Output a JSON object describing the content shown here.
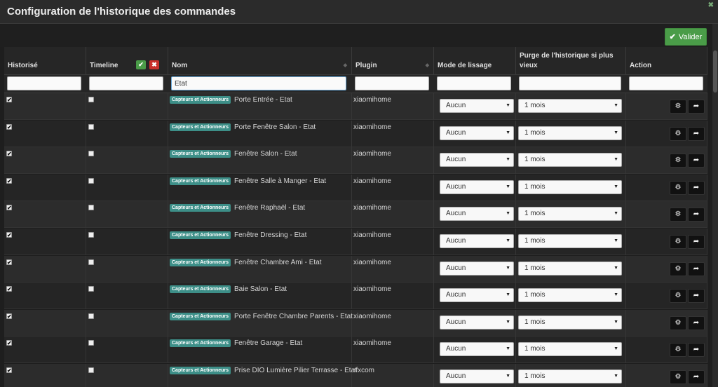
{
  "window": {
    "title": "Configuration de l'historique des commandes",
    "close_icon": "close-icon"
  },
  "toolbar": {
    "validate_label": "Valider"
  },
  "columns": {
    "historise": "Historisé",
    "timeline": "Timeline",
    "nom": "Nom",
    "plugin": "Plugin",
    "mode": "Mode de lissage",
    "purge": "Purge de l'historique si plus vieux",
    "action": "Action"
  },
  "filters": {
    "historise": "",
    "timeline": "",
    "nom": "Etat",
    "plugin": "",
    "mode": "",
    "purge": "",
    "action": ""
  },
  "rows": [
    {
      "historise": true,
      "timeline": false,
      "category": "Capteurs et Actionneurs",
      "name": "Porte Entrée - Etat",
      "plugin": "xiaomihome",
      "mode": "Aucun",
      "purge": "1 mois"
    },
    {
      "historise": true,
      "timeline": false,
      "category": "Capteurs et Actionneurs",
      "name": "Porte Fenêtre Salon - Etat",
      "plugin": "xiaomihome",
      "mode": "Aucun",
      "purge": "1 mois"
    },
    {
      "historise": true,
      "timeline": false,
      "category": "Capteurs et Actionneurs",
      "name": "Fenêtre Salon - Etat",
      "plugin": "xiaomihome",
      "mode": "Aucun",
      "purge": "1 mois"
    },
    {
      "historise": true,
      "timeline": false,
      "category": "Capteurs et Actionneurs",
      "name": "Fenêtre Salle à Manger - Etat",
      "plugin": "xiaomihome",
      "mode": "Aucun",
      "purge": "1 mois"
    },
    {
      "historise": true,
      "timeline": false,
      "category": "Capteurs et Actionneurs",
      "name": "Fenêtre Raphaël - Etat",
      "plugin": "xiaomihome",
      "mode": "Aucun",
      "purge": "1 mois"
    },
    {
      "historise": true,
      "timeline": false,
      "category": "Capteurs et Actionneurs",
      "name": "Fenêtre Dressing - Etat",
      "plugin": "xiaomihome",
      "mode": "Aucun",
      "purge": "1 mois"
    },
    {
      "historise": true,
      "timeline": false,
      "category": "Capteurs et Actionneurs",
      "name": "Fenêtre Chambre Ami - Etat",
      "plugin": "xiaomihome",
      "mode": "Aucun",
      "purge": "1 mois"
    },
    {
      "historise": true,
      "timeline": false,
      "category": "Capteurs et Actionneurs",
      "name": "Baie Salon - Etat",
      "plugin": "xiaomihome",
      "mode": "Aucun",
      "purge": "1 mois"
    },
    {
      "historise": true,
      "timeline": false,
      "category": "Capteurs et Actionneurs",
      "name": "Porte Fenêtre Chambre Parents - Etat",
      "plugin": "xiaomihome",
      "mode": "Aucun",
      "purge": "1 mois"
    },
    {
      "historise": true,
      "timeline": false,
      "category": "Capteurs et Actionneurs",
      "name": "Fenêtre Garage - Etat",
      "plugin": "xiaomihome",
      "mode": "Aucun",
      "purge": "1 mois"
    },
    {
      "historise": true,
      "timeline": false,
      "category": "Capteurs et Actionneurs",
      "name": "Prise DIO Lumière Pilier Terrasse - Etat",
      "plugin": "rfxcom",
      "mode": "Aucun",
      "purge": "1 mois"
    }
  ],
  "icons": {
    "validate": "check-icon",
    "timeline_enable": "check-icon",
    "timeline_disable": "cross-icon",
    "sort": "sort-icon",
    "configure": "gears-icon",
    "goto": "share-arrow-icon"
  },
  "colors": {
    "accent_green": "#4a9c48",
    "danger_red": "#c9302c",
    "tag_teal": "#3d8f88"
  }
}
